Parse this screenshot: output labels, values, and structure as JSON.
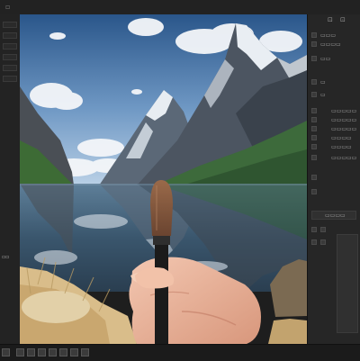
{
  "topbar": {
    "tag_a": "▫",
    "tag_b": "⊡"
  },
  "left_toolbar": {
    "buttons": [
      "",
      "",
      "",
      "",
      "",
      ""
    ],
    "tag_bottom": "▫▫"
  },
  "right_panel": {
    "header_icons": [
      "⊡",
      "⊡"
    ],
    "rows": [
      {
        "sq": "",
        "label": "▭▭▭"
      },
      {
        "sq": "",
        "label": "▭▭▭▭"
      },
      {
        "sq": "",
        "label": "▭▭"
      },
      {
        "sq": "",
        "label": "▭"
      },
      {
        "sq": "",
        "label": "▭"
      },
      {
        "sq": "",
        "label": "▭▭▭▭▭"
      },
      {
        "sq": "",
        "label": "▭▭▭▭▭"
      },
      {
        "sq": "",
        "label": "▭▭▭▭▭"
      },
      {
        "sq": "",
        "label": "▭▭▭▭"
      },
      {
        "sq": "",
        "label": "▭▭▭▭"
      },
      {
        "sq": "",
        "label": "▭▭▭▭▭"
      }
    ],
    "lower_label": "▭▭▭▭"
  },
  "colors": {
    "ui_dark": "#1e1e1e",
    "panel": "#262626",
    "sky_top": "#2e5c8f",
    "sky_bottom": "#a8c4de",
    "lake": "#2f4a5e",
    "forest": "#3c6a3a"
  },
  "icons": {
    "brush": "paint-brush-icon",
    "hand": "hand-icon"
  }
}
